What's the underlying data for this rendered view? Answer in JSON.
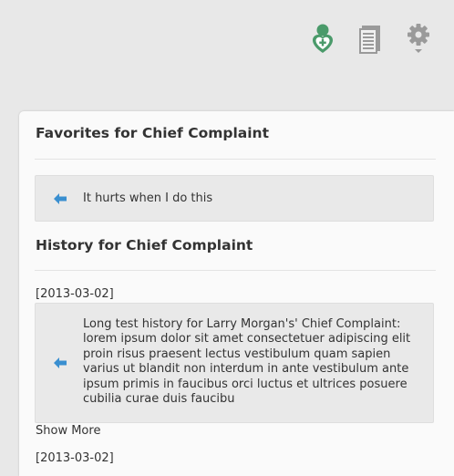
{
  "favorites": {
    "title": "Favorites for Chief Complaint",
    "items": [
      {
        "text": "It hurts when I do this",
        "icon": "arrow-left-icon"
      }
    ]
  },
  "history": {
    "title": "History for Chief Complaint",
    "entries": [
      {
        "date": "[2013-03-02]",
        "lines": [
          "Long test history for Larry Morgan's' Chief Complaint:",
          "lorem ipsum dolor sit amet consectetuer adipiscing elit",
          "proin risus praesent lectus vestibulum quam sapien",
          "varius ut blandit non interdum in ante vestibulum ante",
          "ipsum primis in faucibus orci luctus et ultrices posuere",
          "cubilia curae duis faucibu"
        ],
        "show_more": "Show More"
      },
      {
        "date": "[2013-03-02]"
      }
    ]
  },
  "toolbar": {
    "icons": [
      "patient-icon",
      "notes-icon",
      "settings-icon"
    ]
  },
  "colors": {
    "accent_green": "#4a9a6a",
    "arrow_blue": "#3a8fd0",
    "icon_gray": "#9a9a9a"
  }
}
